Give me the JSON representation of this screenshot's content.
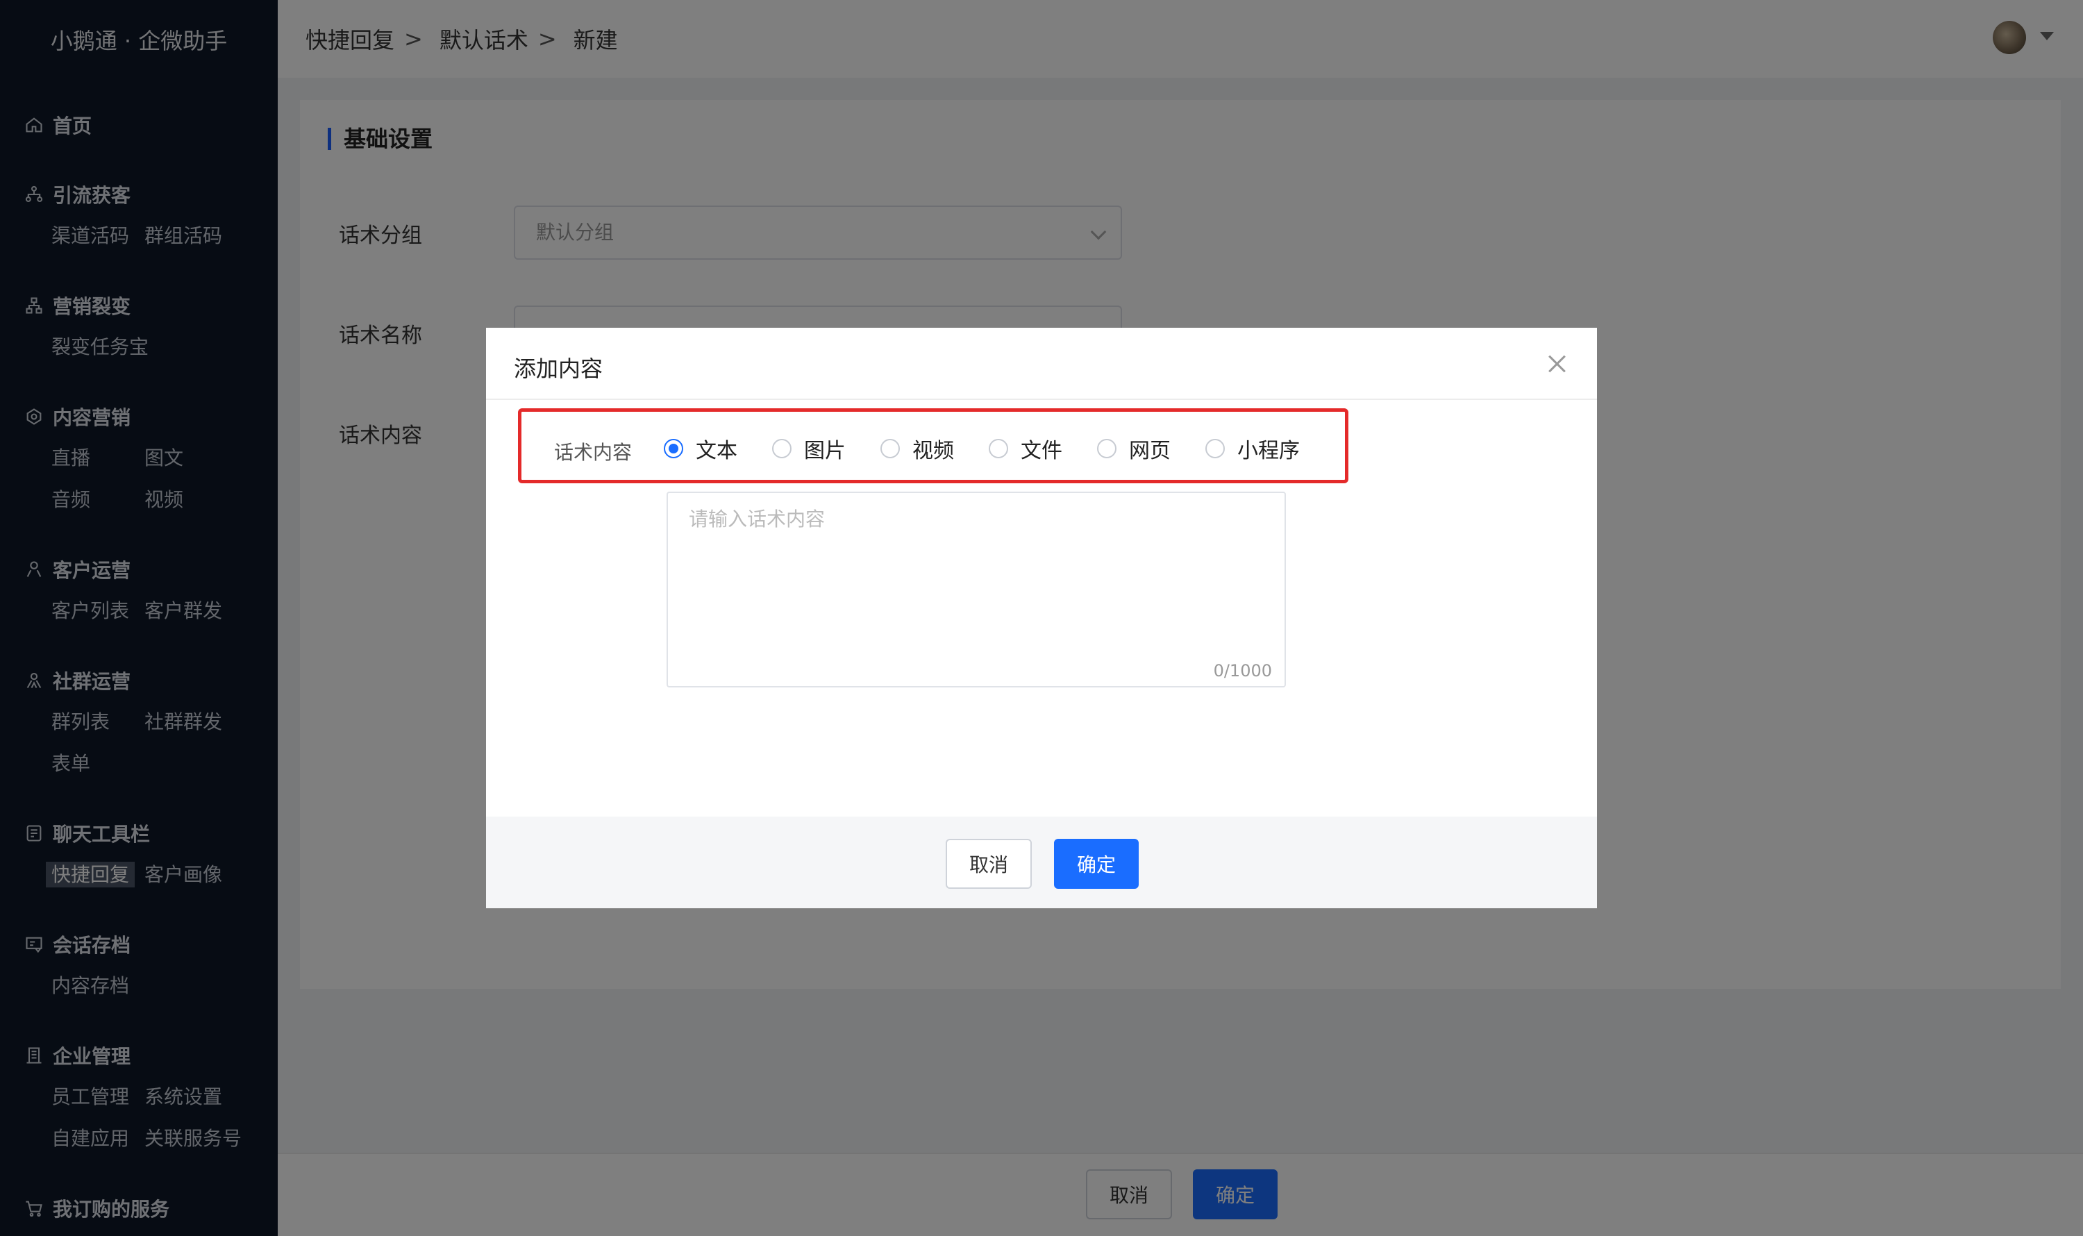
{
  "app": {
    "brand": "小鹅通 · 企微助手"
  },
  "sidebar": {
    "groups": [
      {
        "title": "首页",
        "icon": "home-icon",
        "items": []
      },
      {
        "title": "引流获客",
        "icon": "network-icon",
        "items": [
          "渠道活码",
          "群组活码"
        ]
      },
      {
        "title": "营销裂变",
        "icon": "hierarchy-icon",
        "items": [
          "裂变任务宝"
        ]
      },
      {
        "title": "内容营销",
        "icon": "content-icon",
        "items": [
          "直播",
          "图文",
          "音频",
          "视频"
        ]
      },
      {
        "title": "客户运营",
        "icon": "user-icon",
        "items": [
          "客户列表",
          "客户群发"
        ]
      },
      {
        "title": "社群运营",
        "icon": "group-icon",
        "items": [
          "群列表",
          "社群群发",
          "表单"
        ]
      },
      {
        "title": "聊天工具栏",
        "icon": "chat-tool-icon",
        "items": [
          "快捷回复",
          "客户画像"
        ]
      },
      {
        "title": "会话存档",
        "icon": "archive-icon",
        "items": [
          "内容存档"
        ]
      },
      {
        "title": "企业管理",
        "icon": "building-icon",
        "items": [
          "员工管理",
          "系统设置",
          "自建应用",
          "关联服务号"
        ]
      },
      {
        "title": "我订购的服务",
        "icon": "cart-icon",
        "items": []
      }
    ],
    "active_item": "快捷回复"
  },
  "header": {
    "breadcrumb": [
      "快捷回复",
      "默认话术",
      "新建"
    ],
    "separator": ">"
  },
  "form": {
    "section_title": "基础设置",
    "group_label": "话术分组",
    "group_value": "默认分组",
    "name_label": "话术名称",
    "content_label": "话术内容"
  },
  "footer": {
    "cancel": "取消",
    "confirm": "确定"
  },
  "modal": {
    "title": "添加内容",
    "radio_label": "话术内容",
    "options": [
      "文本",
      "图片",
      "视频",
      "文件",
      "网页",
      "小程序"
    ],
    "selected": "文本",
    "placeholder": "请输入话术内容",
    "char_count": "0/1000",
    "cancel": "取消",
    "confirm": "确定"
  },
  "colors": {
    "sidebar_bg": "#0f1829",
    "primary": "#1a6dff",
    "highlight": "#e42a2a"
  }
}
